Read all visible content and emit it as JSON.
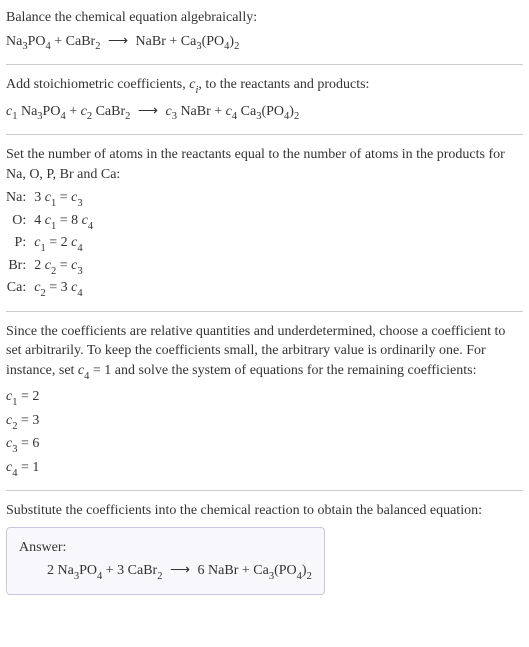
{
  "intro": {
    "line1": "Balance the chemical equation algebraically:"
  },
  "reactants": {
    "r1": "Na",
    "r1s": "3",
    "r1b": "PO",
    "r1bs": "4",
    "plus": " + ",
    "r2": "CaBr",
    "r2s": "2"
  },
  "products": {
    "p1": "NaBr",
    "p2": "Ca",
    "p2s": "3",
    "p2b": "(PO",
    "p2bs": "4",
    "p2c": ")",
    "p2cs": "2"
  },
  "arrow": "⟶",
  "step2": {
    "text1": "Add stoichiometric coefficients, ",
    "ci": "c",
    "cisub": "i",
    "text2": ", to the reactants and products:"
  },
  "coefs": {
    "c1": "c",
    "c1s": "1",
    "c2": "c",
    "c2s": "2",
    "c3": "c",
    "c3s": "3",
    "c4": "c",
    "c4s": "4"
  },
  "step3": {
    "text": "Set the number of atoms in the reactants equal to the number of atoms in the products for Na, O, P, Br and Ca:"
  },
  "atoms": [
    {
      "label": "Na:",
      "eq_a": "3 ",
      "eq_b": " = "
    },
    {
      "label": "O:",
      "eq_a": "4 ",
      "eq_b": " = 8 "
    },
    {
      "label": "P:",
      "eq_a": "",
      "eq_b": " = 2 "
    },
    {
      "label": "Br:",
      "eq_a": "2 ",
      "eq_b": " = "
    },
    {
      "label": "Ca:",
      "eq_a": "",
      "eq_b": " = 3 "
    }
  ],
  "step4": {
    "text1": "Since the coefficients are relative quantities and underdetermined, choose a coefficient to set arbitrarily. To keep the coefficients small, the arbitrary value is ordinarily one. For instance, set ",
    "text2": " = 1 and solve the system of equations for the remaining coefficients:"
  },
  "solutions": {
    "s1": " = 2",
    "s2": " = 3",
    "s3": " = 6",
    "s4": " = 1"
  },
  "step5": {
    "text": "Substitute the coefficients into the chemical reaction to obtain the balanced equation:"
  },
  "answer": {
    "label": "Answer:",
    "n1": "2 ",
    "n2": " + 3 ",
    "n3": "6 ",
    "n4": " + "
  }
}
